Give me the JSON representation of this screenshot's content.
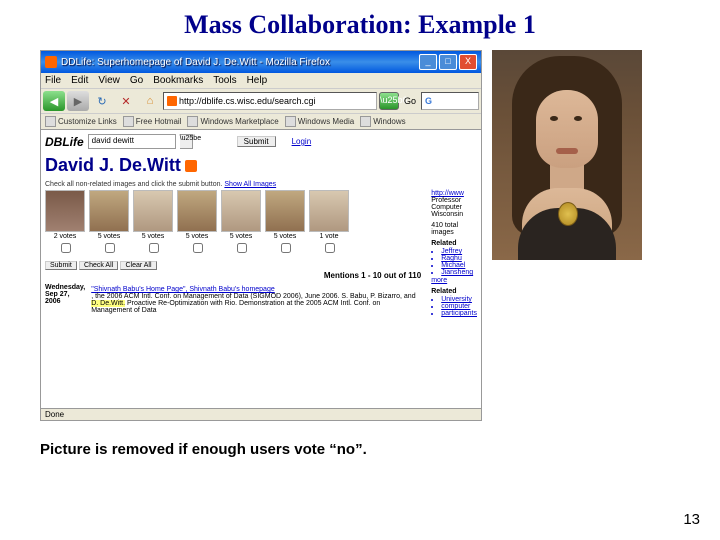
{
  "slide": {
    "title": "Mass Collaboration: Example 1",
    "caption": "Picture is removed if enough users vote “no”.",
    "page": "13"
  },
  "browser": {
    "windowTitle": "DDLife: Superhomepage of David J. De.Witt - Mozilla Firefox",
    "close": "X",
    "minimize": "_",
    "maximize": "□",
    "menu": {
      "file": "File",
      "edit": "Edit",
      "view": "View",
      "go": "Go",
      "bookmarks": "Bookmarks",
      "tools": "Tools",
      "help": "Help"
    },
    "toolbar": {
      "back": "◀",
      "forward": "▶",
      "reload": "↻",
      "stop": "✕",
      "home": "⌂",
      "url": "http://dblife.cs.wisc.edu/search.cgi",
      "go": "Go",
      "google": "G"
    },
    "bookmarks": [
      "Customize Links",
      "Free Hotmail",
      "Windows Marketplace",
      "Windows Media",
      "Windows"
    ],
    "status": "Done"
  },
  "page": {
    "logo": "DBLife",
    "searchValue": "david dewitt",
    "submit": "Submit",
    "login": "Login",
    "name": "David J. De.Witt",
    "instruction": "Check all non-related images and click the submit button.",
    "showAll": "Show All Images",
    "thumbs": [
      {
        "votes": "2 votes"
      },
      {
        "votes": "5 votes"
      },
      {
        "votes": "5 votes"
      },
      {
        "votes": "5 votes"
      },
      {
        "votes": "5 votes"
      },
      {
        "votes": "5 votes"
      },
      {
        "votes": "1 vote"
      }
    ],
    "buttons": {
      "submit": "Submit",
      "checkAll": "Check All",
      "clearAll": "Clear All"
    },
    "mentions": "Mentions 1 - 10 out of 110",
    "date": {
      "day": "Wednesday,",
      "full": "Sep 27, 2006"
    },
    "homepage": "\"Shivnath Babu's Home Page\", Shivnath Babu's homepage",
    "snippet1": ", the 2006 ACM Intl. Conf. on Management of Data (SIGMOD 2006), June 2006. S. Babu, P. Bizarro, and ",
    "highlight": "D. De.Witt.",
    "snippet2": " Proactive Re-Optimization with Rio. Demonstration at the 2005 ACM Intl. Conf. on Management of Data",
    "side": {
      "url": "http://www",
      "role": "Professor",
      "dept": "Computer",
      "univ": "Wisconsin",
      "total": "410 total",
      "images": "images",
      "related": "Related",
      "items1": [
        "Jeffrey",
        "Raghu",
        "Michael",
        "Jiansheng"
      ],
      "more": "more",
      "related2": "Related",
      "items2": [
        "University",
        "computer",
        "participants"
      ]
    }
  }
}
